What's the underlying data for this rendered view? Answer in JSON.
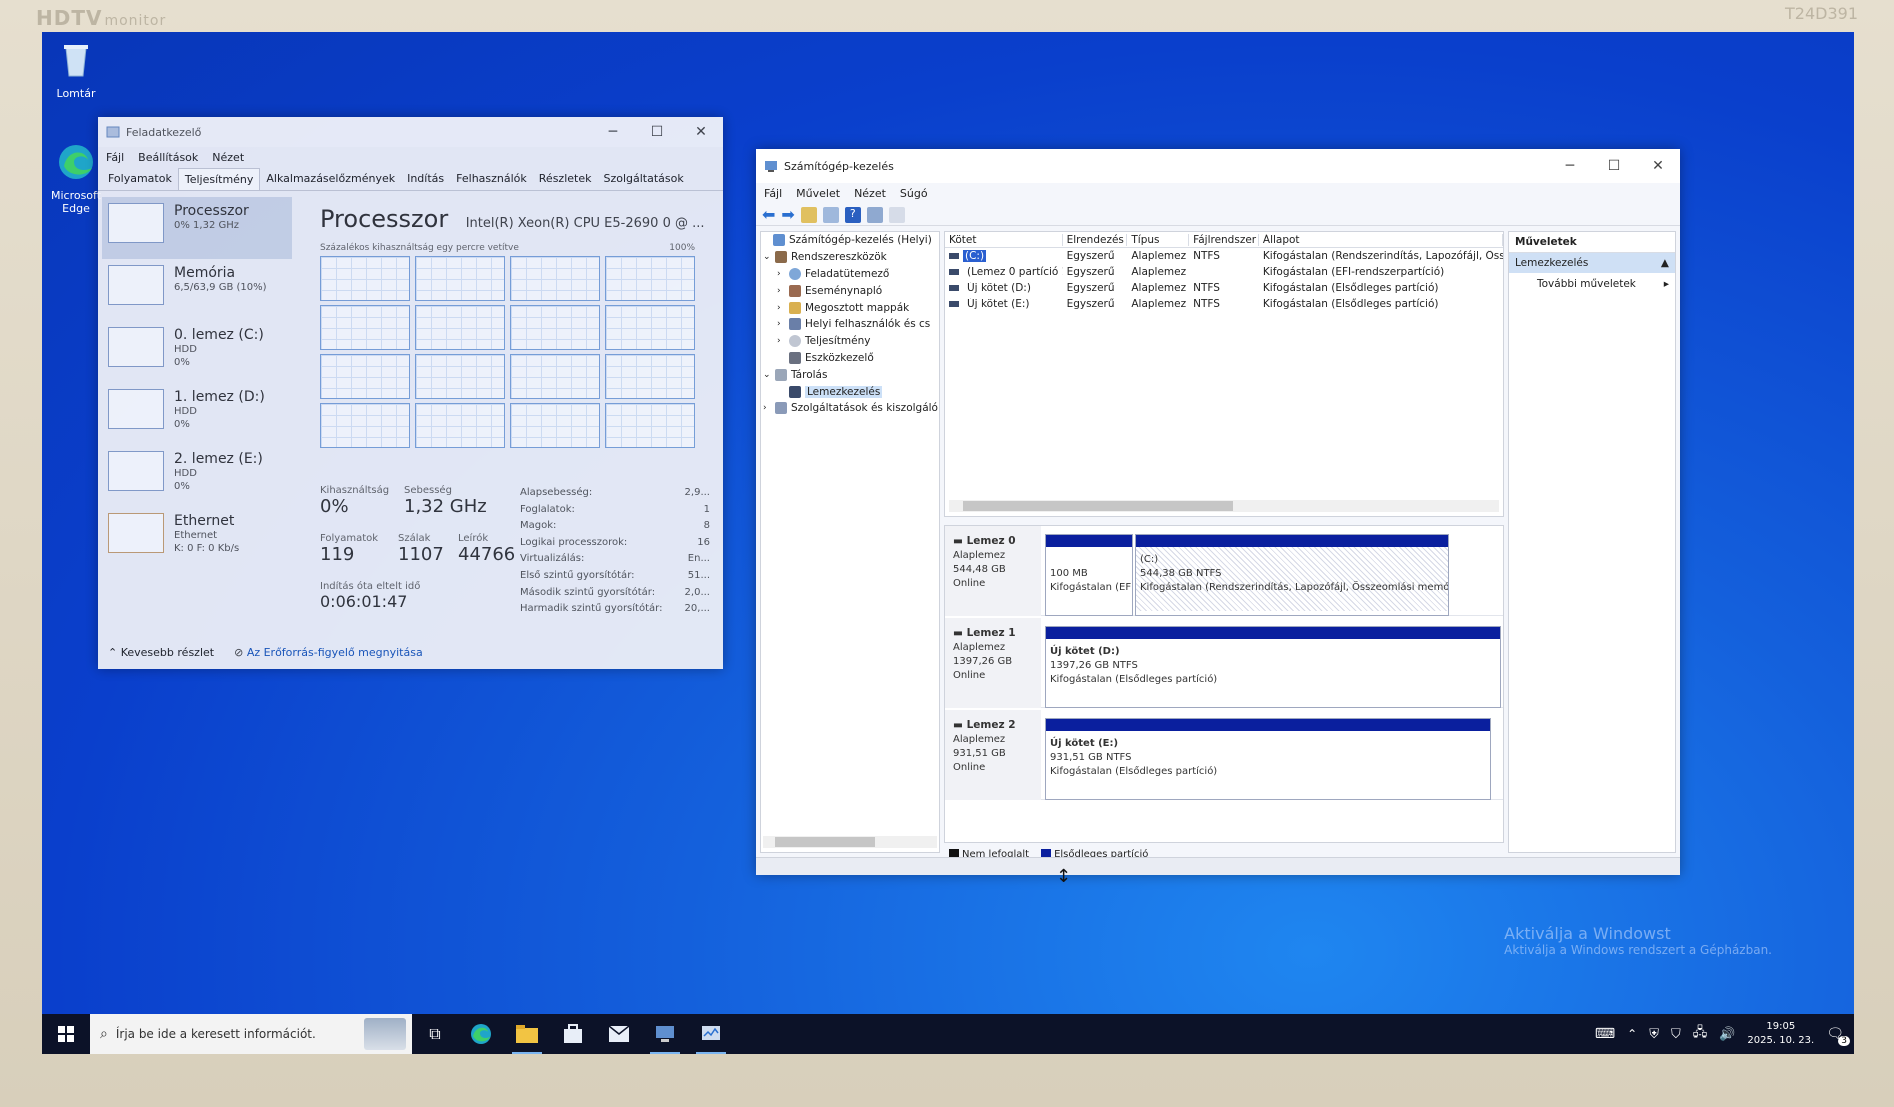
{
  "bezel": {
    "brand": "HDTV",
    "brand_sub": "monitor",
    "model": "T24D391"
  },
  "desktop": {
    "icons": [
      {
        "name": "recycle-bin",
        "label": "Lomtár"
      },
      {
        "name": "edge",
        "label": "Microsoft Edge"
      }
    ]
  },
  "taskmgr": {
    "title": "Feladatkezelő",
    "menu": [
      "Fájl",
      "Beállítások",
      "Nézet"
    ],
    "tabs": [
      "Folyamatok",
      "Teljesítmény",
      "Alkalmazáselőzmények",
      "Indítás",
      "Felhasználók",
      "Részletek",
      "Szolgáltatások"
    ],
    "active_tab": "Teljesítmény",
    "perf_items": [
      {
        "name": "Processzor",
        "sub1": "0% 1,32 GHz",
        "sub2": ""
      },
      {
        "name": "Memória",
        "sub1": "6,5/63,9 GB (10%)",
        "sub2": ""
      },
      {
        "name": "0. lemez (C:)",
        "sub1": "HDD",
        "sub2": "0%"
      },
      {
        "name": "1. lemez (D:)",
        "sub1": "HDD",
        "sub2": "0%"
      },
      {
        "name": "2. lemez (E:)",
        "sub1": "HDD",
        "sub2": "0%"
      },
      {
        "name": "Ethernet",
        "sub1": "Ethernet",
        "sub2": "K: 0 F: 0 Kb/s"
      }
    ],
    "main_title": "Processzor",
    "cpu_name": "Intel(R) Xeon(R) CPU E5-2690 0 @ ...",
    "graph_label": "Százalékos kihasználtság egy percre vetítve",
    "graph_max": "100%",
    "stats": {
      "util_label": "Kihasználtság",
      "util": "0%",
      "speed_label": "Sebesség",
      "speed": "1,32 GHz",
      "proc_label": "Folyamatok",
      "proc": "119",
      "threads_label": "Szálak",
      "threads": "1107",
      "handles_label": "Leírók",
      "handles": "44766",
      "uptime_label": "Indítás óta eltelt idő",
      "uptime": "0:06:01:47"
    },
    "details": [
      {
        "k": "Alapsebesség:",
        "v": "2,9..."
      },
      {
        "k": "Foglalatok:",
        "v": "1"
      },
      {
        "k": "Magok:",
        "v": "8"
      },
      {
        "k": "Logikai processzorok:",
        "v": "16"
      },
      {
        "k": "Virtualizálás:",
        "v": "En..."
      },
      {
        "k": "Első szintű gyorsítótár:",
        "v": "51..."
      },
      {
        "k": "Második szintű gyorsítótár:",
        "v": "2,0..."
      },
      {
        "k": "Harmadik szintű gyorsítótár:",
        "v": "20,..."
      }
    ],
    "footer_less": "Kevesebb részlet",
    "footer_link": "Az Erőforrás-figyelő megnyitása"
  },
  "compmgmt": {
    "title": "Számítógép-kezelés",
    "menu": [
      "Fájl",
      "Művelet",
      "Nézet",
      "Súgó"
    ],
    "tree": [
      {
        "label": "Számítógép-kezelés (Helyi)",
        "indent": 0,
        "exp": ""
      },
      {
        "label": "Rendszereszközök",
        "indent": 1,
        "exp": "⌄"
      },
      {
        "label": "Feladatütemező",
        "indent": 2,
        "exp": "›"
      },
      {
        "label": "Eseménynapló",
        "indent": 2,
        "exp": "›"
      },
      {
        "label": "Megosztott mappák",
        "indent": 2,
        "exp": "›"
      },
      {
        "label": "Helyi felhasználók és cs",
        "indent": 2,
        "exp": "›"
      },
      {
        "label": "Teljesítmény",
        "indent": 2,
        "exp": "›"
      },
      {
        "label": "Eszközkezelő",
        "indent": 2,
        "exp": ""
      },
      {
        "label": "Tárolás",
        "indent": 1,
        "exp": "⌄"
      },
      {
        "label": "Lemezkezelés",
        "indent": 2,
        "exp": "",
        "selected": true
      },
      {
        "label": "Szolgáltatások és kiszolgáló",
        "indent": 1,
        "exp": "›"
      }
    ],
    "columns": [
      "Kötet",
      "Elrendezés",
      "Típus",
      "Fájlrendszer",
      "Állapot"
    ],
    "volumes": [
      {
        "kotet": "(C:)",
        "elr": "Egyszerű",
        "tipus": "Alaplemez",
        "fs": "NTFS",
        "allapot": "Kifogástalan (Rendszerindítás, Lapozófájl, Összec"
      },
      {
        "kotet": "(Lemez 0 partíció 1)",
        "elr": "Egyszerű",
        "tipus": "Alaplemez",
        "fs": "",
        "allapot": "Kifogástalan (EFI-rendszerpartíció)"
      },
      {
        "kotet": "Új kötet (D:)",
        "elr": "Egyszerű",
        "tipus": "Alaplemez",
        "fs": "NTFS",
        "allapot": "Kifogástalan (Elsődleges partíció)"
      },
      {
        "kotet": "Új kötet (E:)",
        "elr": "Egyszerű",
        "tipus": "Alaplemez",
        "fs": "NTFS",
        "allapot": "Kifogástalan (Elsődleges partíció)"
      }
    ],
    "disks": [
      {
        "name": "Lemez 0",
        "type": "Alaplemez",
        "size": "544,48 GB",
        "status": "Online",
        "parts": [
          {
            "l1": "",
            "l2": "100 MB",
            "l3": "Kifogástalan (EFI-re"
          },
          {
            "l1": "(C:)",
            "l2": "544,38 GB NTFS",
            "l3": "Kifogástalan (Rendszerindítás, Lapozófájl, Összeomlási memó"
          }
        ]
      },
      {
        "name": "Lemez 1",
        "type": "Alaplemez",
        "size": "1397,26 GB",
        "status": "Online",
        "parts": [
          {
            "l1": "Új kötet (D:)",
            "l2": "1397,26 GB NTFS",
            "l3": "Kifogástalan (Elsődleges partíció)"
          }
        ]
      },
      {
        "name": "Lemez 2",
        "type": "Alaplemez",
        "size": "931,51 GB",
        "status": "Online",
        "parts": [
          {
            "l1": "Új kötet (E:)",
            "l2": "931,51 GB NTFS",
            "l3": "Kifogástalan (Elsődleges partíció)"
          }
        ]
      }
    ],
    "legend": [
      "Nem lefoglalt",
      "Elsődleges partíció"
    ],
    "actions_title": "Műveletek",
    "action_selected": "Lemezkezelés",
    "action_more": "További műveletek"
  },
  "activation": {
    "line1": "Aktiválja a Windowst",
    "line2": "Aktiválja a Windows rendszert a Gépházban."
  },
  "taskbar": {
    "search_placeholder": "Írja be ide a keresett információt.",
    "time": "19:05",
    "date": "2025. 10. 23.",
    "notif_count": "3"
  },
  "colors": {
    "partition_bar": "#0a1f9e",
    "unallocated": "#111111",
    "desktop_blue": "#0a3fcc"
  }
}
